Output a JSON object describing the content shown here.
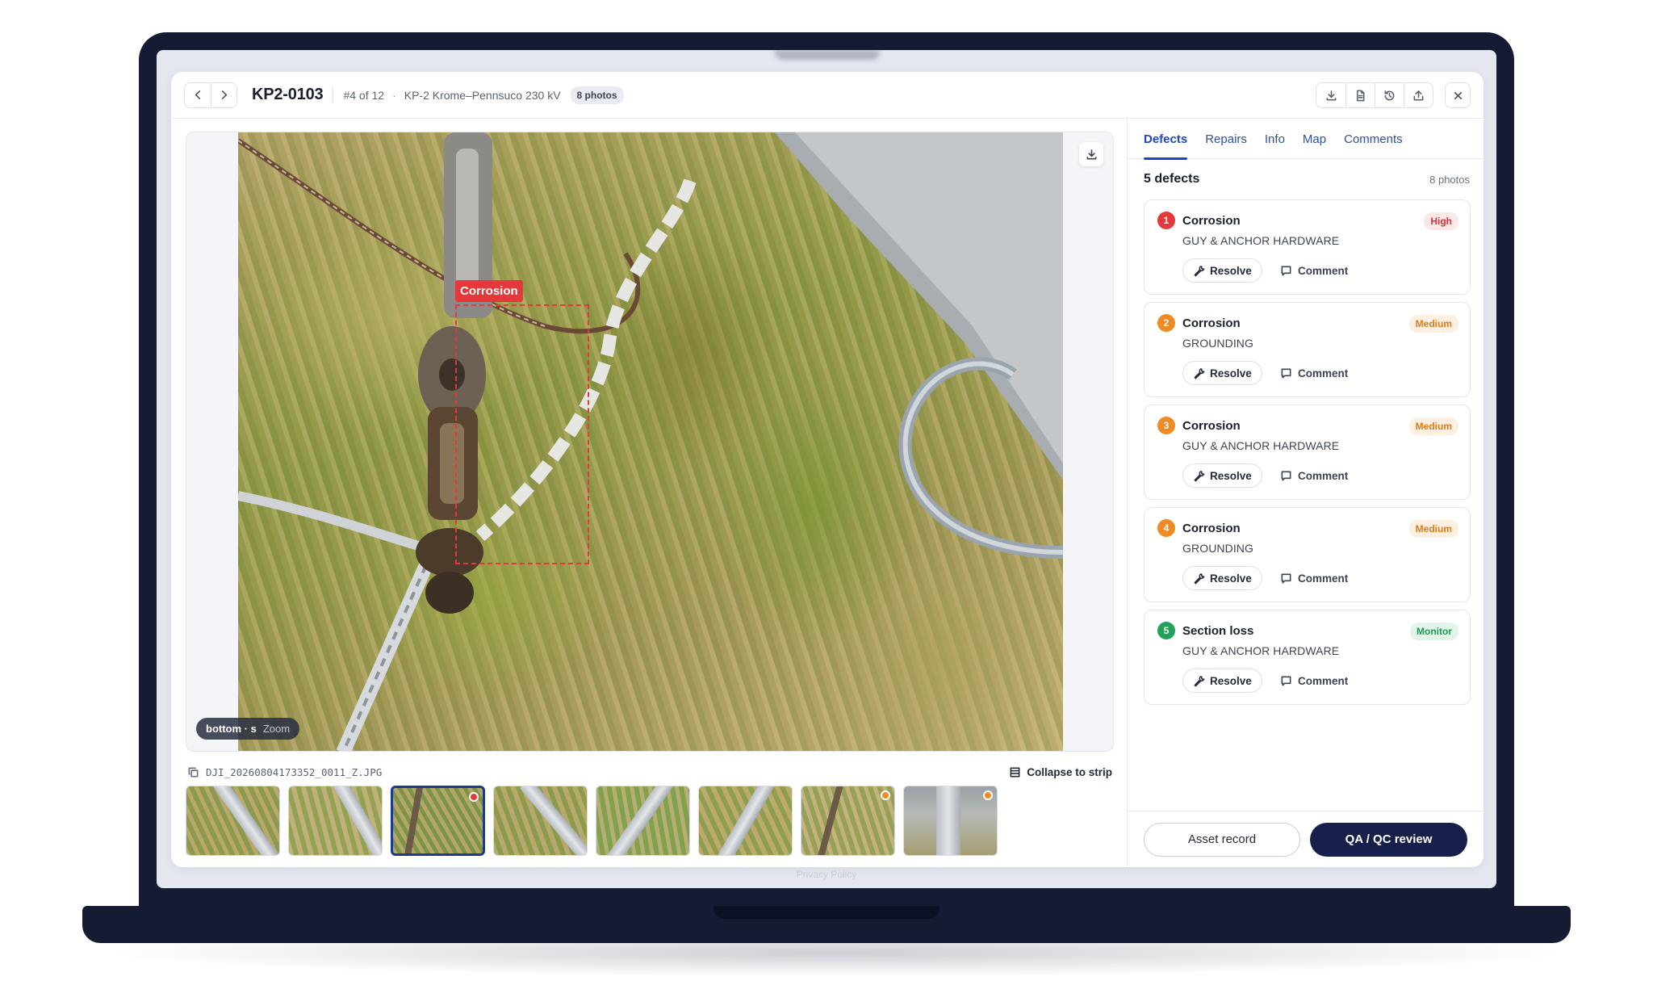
{
  "header": {
    "title": "KP2-0103",
    "position": "#4 of 12",
    "line": "KP-2 Krome–Pennsuco 230 kV",
    "photos_badge": "8 photos"
  },
  "viewer": {
    "annotation_label": "Corrosion",
    "zoom_view": "bottom · s",
    "zoom_label": "Zoom",
    "filename": "DJI_20260804173352_0011_Z.JPG",
    "collapse_label": "Collapse to strip"
  },
  "thumbnails": [
    {
      "marker": null
    },
    {
      "marker": null
    },
    {
      "marker": "#e5383b",
      "active": true
    },
    {
      "marker": null
    },
    {
      "marker": null
    },
    {
      "marker": null
    },
    {
      "marker": "#f08a24"
    },
    {
      "marker": "#f08a24"
    }
  ],
  "tabs": [
    "Defects",
    "Repairs",
    "Info",
    "Map",
    "Comments"
  ],
  "active_tab": "Defects",
  "defects_summary": {
    "count": "5 defects",
    "photos": "8 photos"
  },
  "defects": [
    {
      "num": "1",
      "title": "Corrosion",
      "component": "GUY & ANCHOR HARDWARE",
      "severity": "High",
      "color": "#e5383b",
      "sev_bg": "#fde8e8",
      "sev_fg": "#d6303a"
    },
    {
      "num": "2",
      "title": "Corrosion",
      "component": "GROUNDING",
      "severity": "Medium",
      "color": "#f08a24",
      "sev_bg": "#fdf0e1",
      "sev_fg": "#e07a18"
    },
    {
      "num": "3",
      "title": "Corrosion",
      "component": "GUY & ANCHOR HARDWARE",
      "severity": "Medium",
      "color": "#f08a24",
      "sev_bg": "#fdf0e1",
      "sev_fg": "#e07a18"
    },
    {
      "num": "4",
      "title": "Corrosion",
      "component": "GROUNDING",
      "severity": "Medium",
      "color": "#f08a24",
      "sev_bg": "#fdf0e1",
      "sev_fg": "#e07a18"
    },
    {
      "num": "5",
      "title": "Section loss",
      "component": "GUY & ANCHOR HARDWARE",
      "severity": "Monitor",
      "color": "#22a15a",
      "sev_bg": "#e3f5ea",
      "sev_fg": "#1e9a52"
    }
  ],
  "actions": {
    "resolve": "Resolve",
    "comment": "Comment"
  },
  "footer": {
    "asset_record": "Asset record",
    "qa_review": "QA / QC review"
  },
  "privacy": "Privacy Policy"
}
